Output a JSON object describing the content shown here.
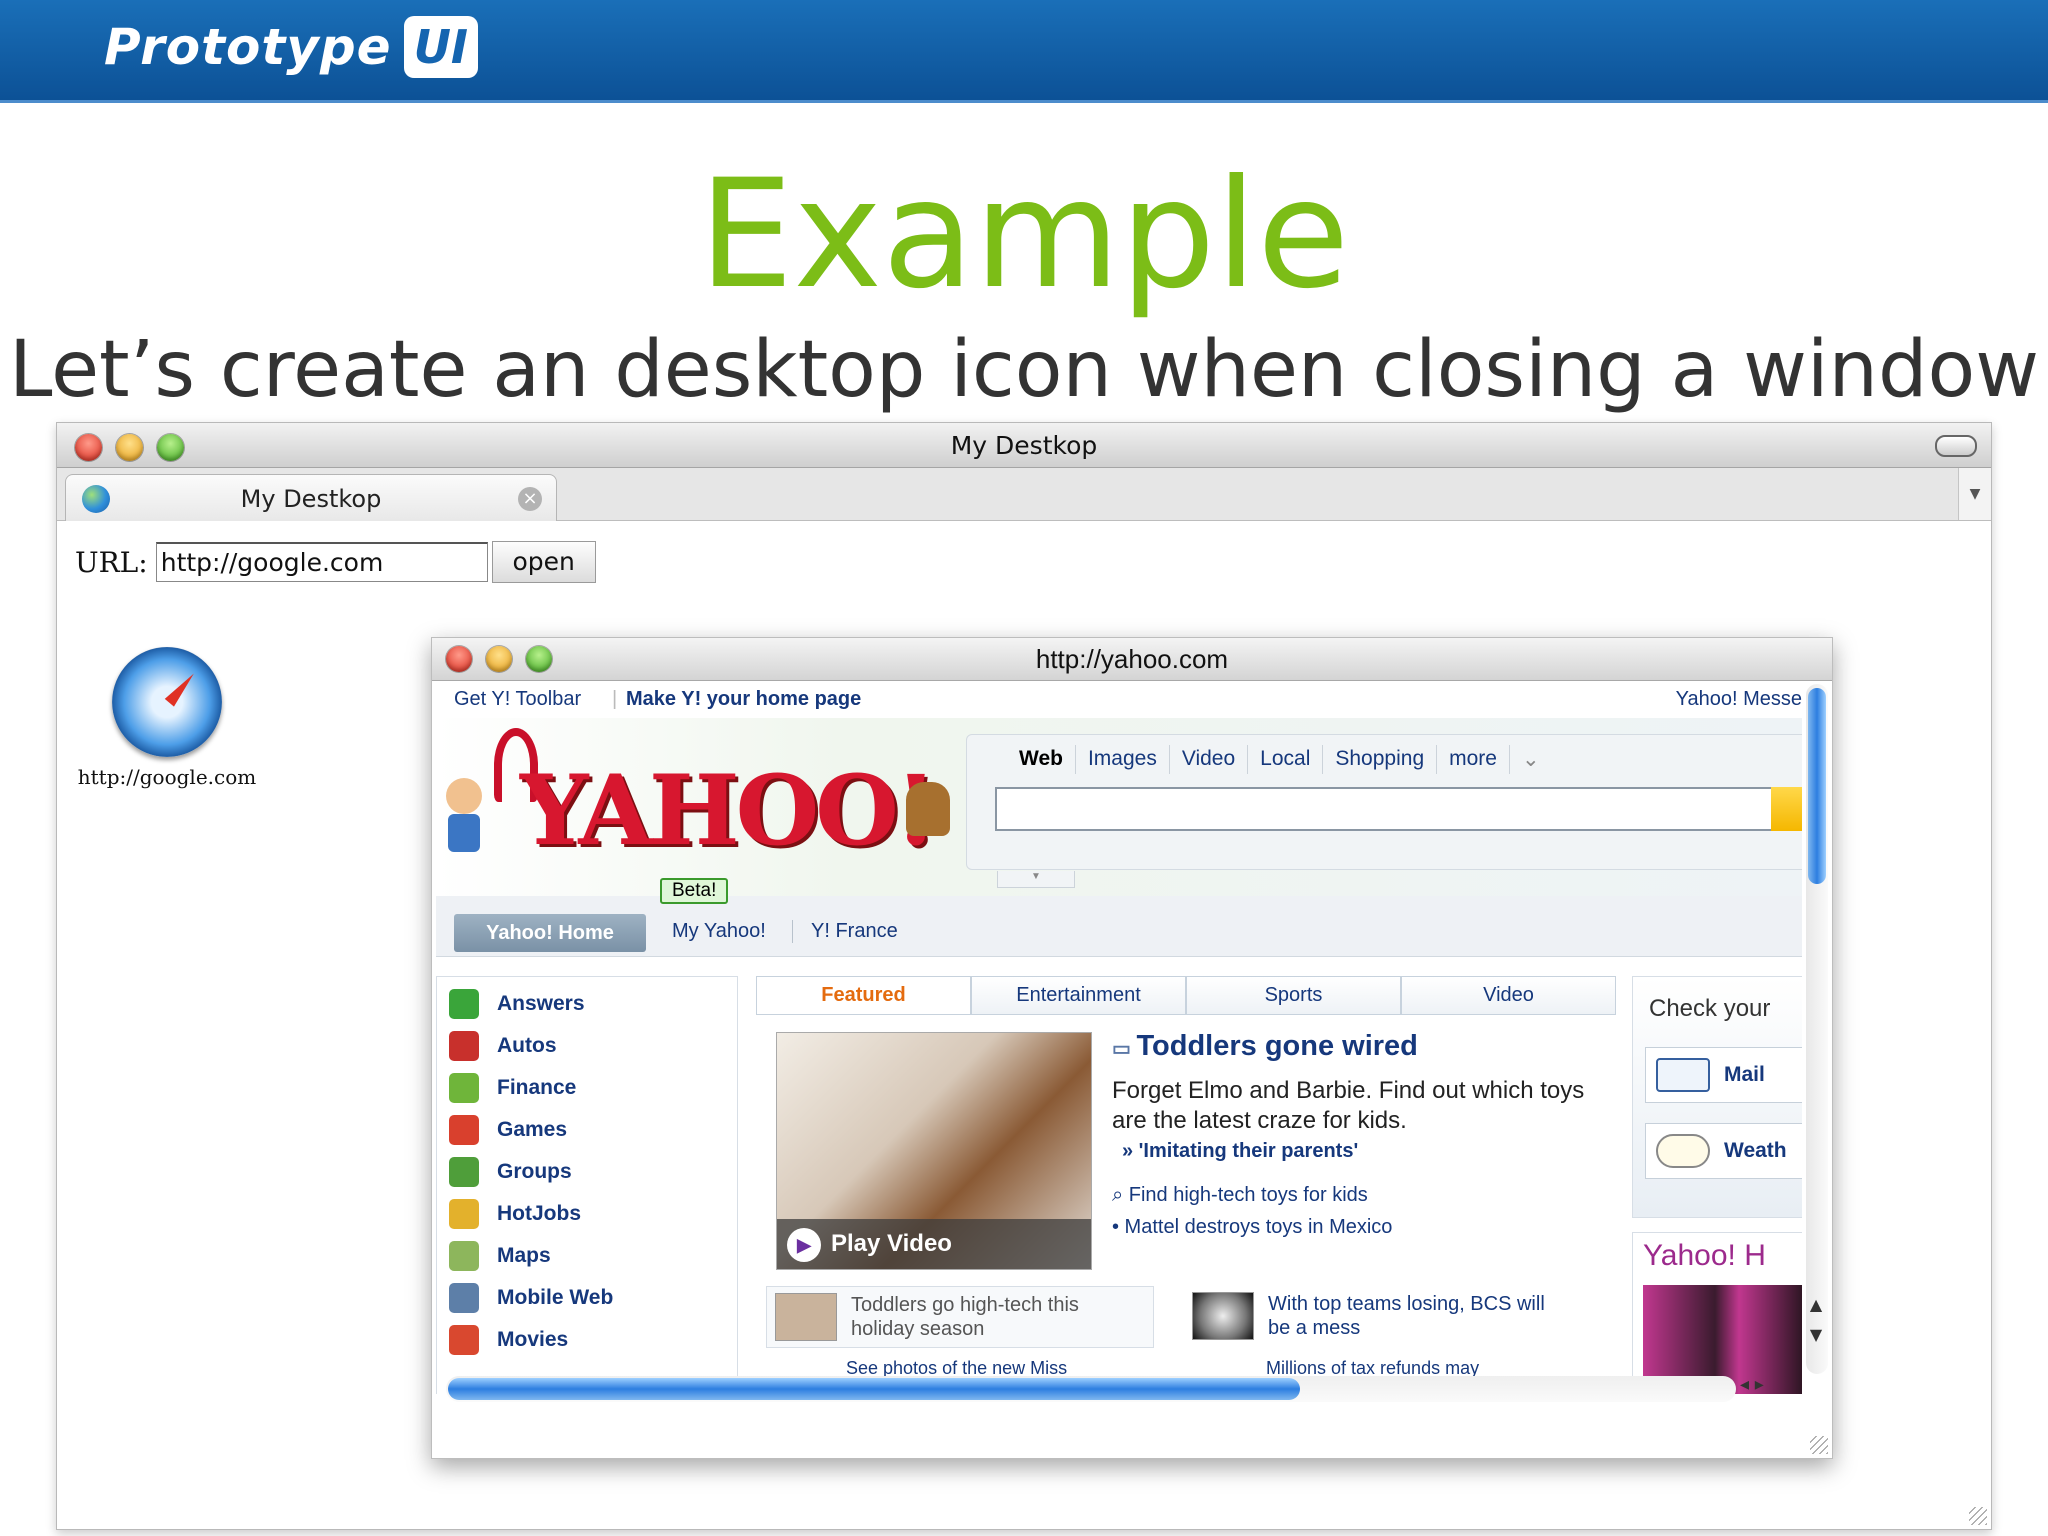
{
  "header": {
    "logo_text": "Prototype",
    "logo_badge": "UI"
  },
  "slide": {
    "title": "Example",
    "subtitle": "Let’s create an desktop icon when closing a window"
  },
  "outer_window": {
    "title": "My Destkop",
    "tab_label": "My Destkop",
    "url_label": "URL:",
    "url_value": "http://google.com",
    "open_label": "open",
    "desktop_icon": {
      "label": "http://google.com",
      "icon": "safari-icon"
    }
  },
  "inner_window": {
    "title": "http://yahoo.com",
    "top_links": {
      "toolbar": "Get Y! Toolbar",
      "homepage": "Make Y! your home page",
      "messenger": "Yahoo! Messe"
    },
    "logo": "YAHOO!",
    "search_tabs": [
      "Web",
      "Images",
      "Video",
      "Local",
      "Shopping",
      "more"
    ],
    "nav": {
      "home": "Yahoo! Home",
      "beta": "Beta!",
      "my_yahoo": "My Yahoo!",
      "france": "Y! France"
    },
    "services": [
      "Answers",
      "Autos",
      "Finance",
      "Games",
      "Groups",
      "HotJobs",
      "Maps",
      "Mobile Web",
      "Movies"
    ],
    "feature_tabs": [
      "Featured",
      "Entertainment",
      "Sports",
      "Video"
    ],
    "featured": {
      "play_label": "Play Video",
      "headline": "Toddlers gone wired",
      "body": "Forget Elmo and Barbie. Find out which toys are the latest craze for kids.",
      "quote_link": "» 'Imitating their parents'",
      "link1": "Find high-tech toys for kids",
      "link2": "• Mattel destroys toys in Mexico"
    },
    "small_stories": [
      {
        "text": "Toddlers go high-tech this holiday season"
      },
      {
        "text": "With top teams losing, BCS will be a mess"
      }
    ],
    "more_stories": [
      "See photos of the new Miss",
      "Millions of tax refunds may"
    ],
    "right": {
      "check": "Check your",
      "mail": "Mail",
      "weather": "Weath",
      "promo": "Yahoo! H"
    }
  },
  "colors": {
    "accent_green": "#7cbd17",
    "yahoo_blue": "#16387c",
    "yahoo_red": "#d7172f",
    "topbar": "#0c5196"
  }
}
